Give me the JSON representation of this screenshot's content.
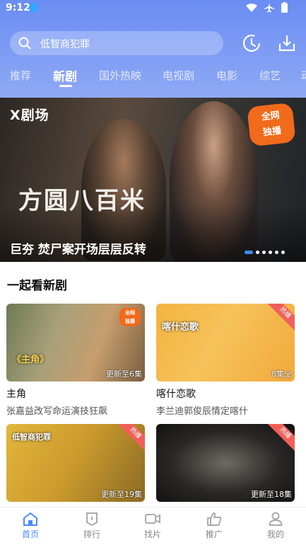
{
  "status": {
    "time": "9:12"
  },
  "search": {
    "placeholder": "低智商犯罪"
  },
  "tabs": [
    "推荐",
    "新剧",
    "国外热映",
    "电视剧",
    "电影",
    "综艺",
    "动"
  ],
  "active_tab": "新剧",
  "banner": {
    "brand": "X剧场",
    "exclusive_label_line1": "全网",
    "exclusive_label_line2": "独播",
    "show_title": "方圆八百米",
    "caption": "巨夯 焚尸案开场层层反转",
    "slides": 6,
    "active_slide": 1
  },
  "section": {
    "title": "一起看新剧"
  },
  "cards": [
    {
      "title": "主角",
      "subtitle": "张嘉益改写命运演技狂飙",
      "badge": "更新至6集",
      "tag": "全网独播",
      "overlay": "《主角》"
    },
    {
      "title": "喀什恋歌",
      "subtitle": "李兰迪郭俊辰情定喀什",
      "badge": "8集全",
      "tag": "热播",
      "overlay": "喀什恋歌"
    },
    {
      "title": "",
      "subtitle": "",
      "badge": "更新至19集",
      "tag": "热播",
      "overlay": "低智商犯罪"
    },
    {
      "title": "",
      "subtitle": "",
      "badge": "更新至18集",
      "tag": "热播",
      "overlay": ""
    }
  ],
  "bottom_nav": [
    {
      "label": "首页",
      "icon": "home-icon",
      "active": true
    },
    {
      "label": "排行",
      "icon": "ranking-icon",
      "active": false
    },
    {
      "label": "找片",
      "icon": "video-icon",
      "active": false
    },
    {
      "label": "推广",
      "icon": "thumb-up-icon",
      "active": false
    },
    {
      "label": "我的",
      "icon": "user-icon",
      "active": false
    }
  ],
  "colors": {
    "accent": "#4a8bff",
    "header_top": "#6a8df3",
    "tag_red": "#f0605a",
    "exclusive_orange": "#f26a1b"
  }
}
